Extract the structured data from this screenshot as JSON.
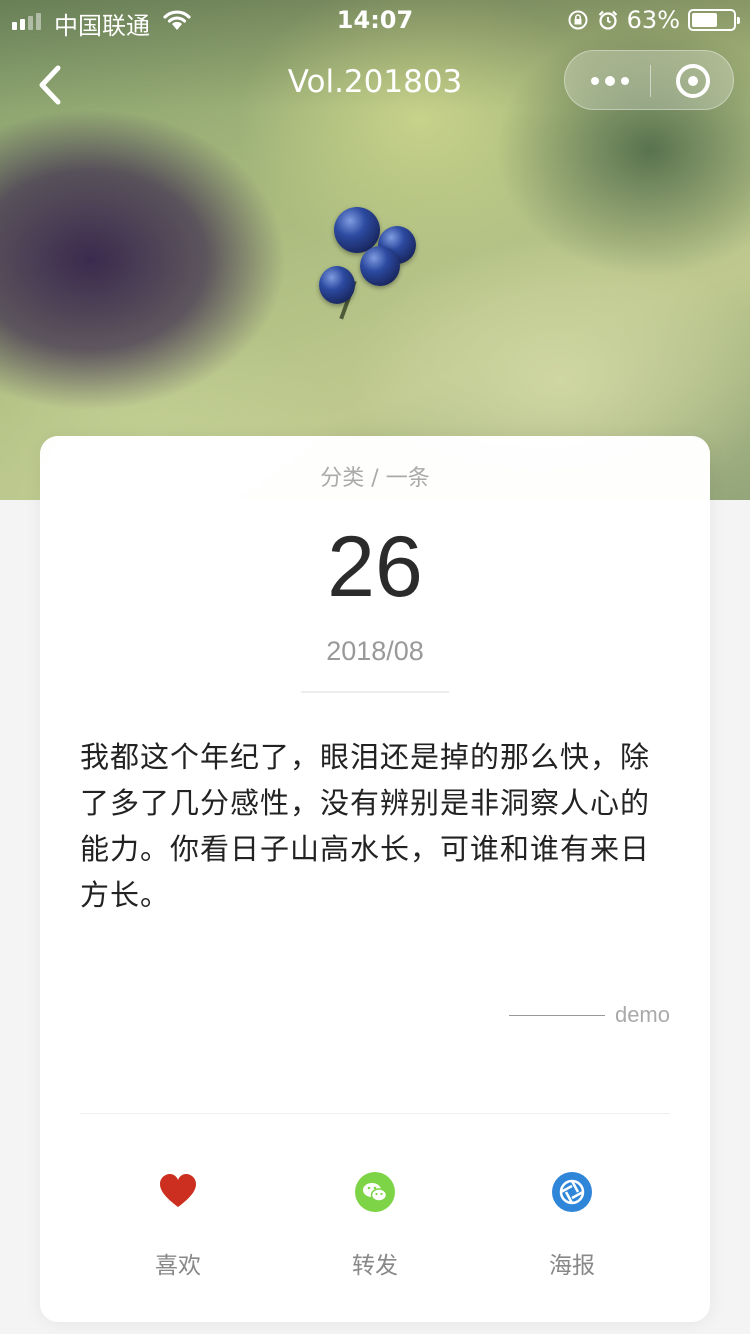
{
  "status_bar": {
    "carrier": "中国联通",
    "time": "14:07",
    "battery": "63%",
    "battery_level": 0.63
  },
  "nav": {
    "title": "Vol.201803"
  },
  "card": {
    "category": "分类 / 一条",
    "day": "26",
    "month": "2018/08",
    "quote": "我都这个年纪了，眼泪还是掉的那么快，除了多了几分感性，没有辨别是非洞察人心的能力。你看日子山高水长，可谁和谁有来日方长。",
    "signature": "demo"
  },
  "actions": [
    {
      "label": "喜欢",
      "icon": "heart-icon",
      "color": "#cc2f1f"
    },
    {
      "label": "转发",
      "icon": "wechat-icon",
      "color": "#7cd446"
    },
    {
      "label": "海报",
      "icon": "aperture-icon",
      "color": "#2f86d8"
    }
  ]
}
